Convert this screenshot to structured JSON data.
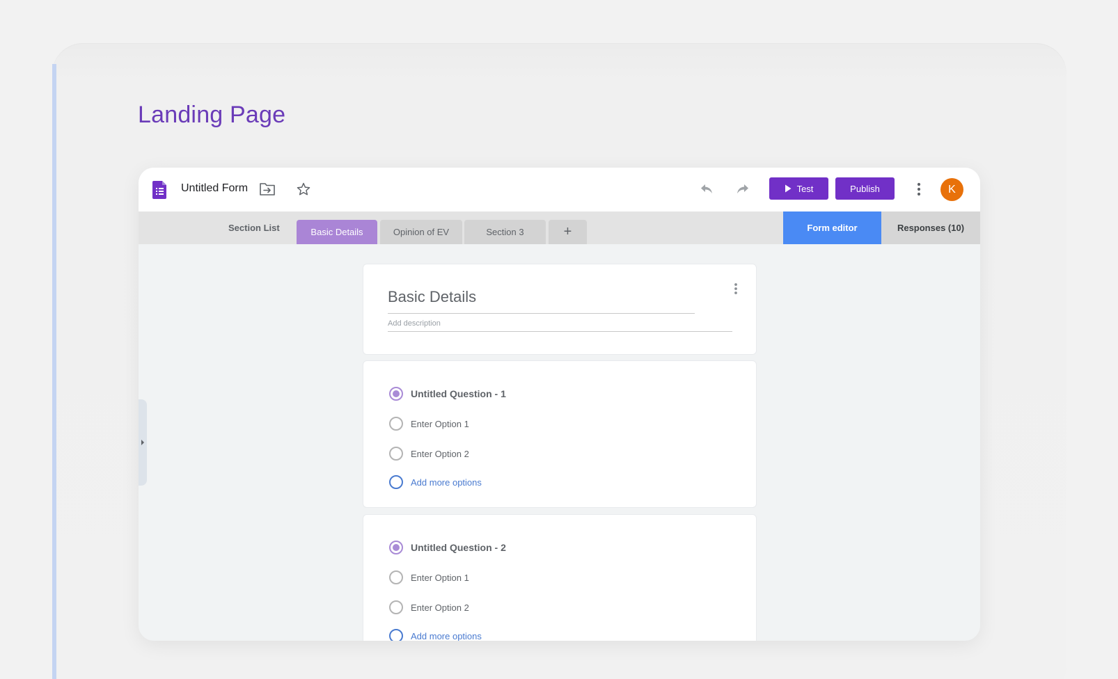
{
  "page": {
    "title": "Landing Page"
  },
  "topbar": {
    "form_name": "Untitled Form",
    "test_label": "Test",
    "publish_label": "Publish",
    "avatar_initial": "K",
    "avatar_color": "#e8710a",
    "accent_color": "#7130c7"
  },
  "tabs": {
    "section_list_label": "Section List",
    "sections": [
      "Basic Details",
      "Opinion of EV",
      "Section 3"
    ],
    "add_label": "+",
    "active_section": "Basic Details",
    "editor_label": "Form editor",
    "responses_label": "Responses (10)"
  },
  "header_card": {
    "title": "Basic Details",
    "description_placeholder": "Add description"
  },
  "questions": [
    {
      "title": "Untitled Question - 1",
      "options": [
        "Enter Option 1",
        "Enter Option 2"
      ],
      "add_label": "Add more options"
    },
    {
      "title": "Untitled Question - 2",
      "options": [
        "Enter Option 1",
        "Enter Option 2"
      ],
      "add_label": "Add more options"
    }
  ],
  "icons": [
    "form-doc-icon",
    "move-to-folder-icon",
    "star-icon",
    "undo-icon",
    "redo-icon",
    "play-icon",
    "more-vert-icon"
  ]
}
